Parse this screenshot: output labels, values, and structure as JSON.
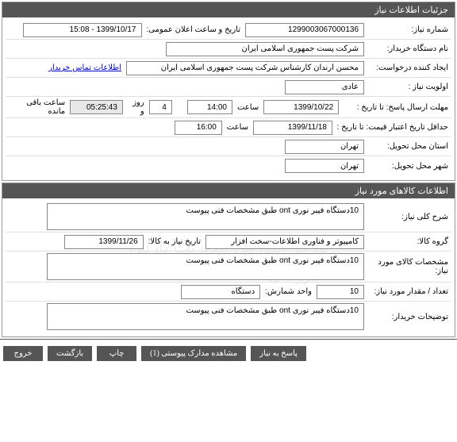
{
  "panel1": {
    "title": "جزئیات اطلاعات نیاز",
    "need_number_label": "شماره نیاز:",
    "need_number": "1299003067000136",
    "public_date_label": "تاریخ و ساعت اعلان عمومی:",
    "public_date": "1399/10/17 - 15:08",
    "buyer_label": "نام دستگاه خریدار:",
    "buyer": "شرکت پست جمهوری اسلامی ایران",
    "creator_label": "ایجاد کننده درخواست:",
    "creator": "محسن ارندان کارشناس شرکت پست جمهوری اسلامی ایران",
    "contact_link": "اطلاعات تماس خریدار",
    "priority_label": "اولویت نیاز :",
    "priority": "عادی",
    "deadline_label": "مهلت ارسال پاسخ:",
    "until_date_label": "تا تاریخ :",
    "until_date": "1399/10/22",
    "hour_label": "ساعت",
    "until_time": "14:00",
    "days_label": "روز و",
    "days_value": "4",
    "remain_time": "05:25:43",
    "remain_label": "ساعت باقی مانده",
    "min_validity_label": "حداقل تاریخ اعتبار قیمت:",
    "validity_until_label": "تا تاریخ :",
    "validity_date": "1399/11/18",
    "validity_time": "16:00",
    "province_label": "استان محل تحویل:",
    "province": "تهران",
    "city_label": "شهر محل تحویل:",
    "city": "تهران"
  },
  "panel2": {
    "title": "اطلاعات کالاهای مورد نیاز",
    "desc_label": "شرح کلی نیاز:",
    "desc": "10دستگاه فیبر نوری ont طبق مشخصات فنی پیوست",
    "group_label": "گروه کالا:",
    "group": "کامپیوتر و فناوری اطلاعات-سخت افزار",
    "delivery_label": "تاریخ نیاز به کالا:",
    "delivery": "1399/11/26",
    "spec_label": "مشخصات کالای مورد نیاز:",
    "spec": "10دستگاه فیبر نوری ont طبق مشخصات فنی پیوست",
    "qty_label": "تعداد / مقدار مورد نیاز:",
    "qty": "10",
    "unit_label": "واحد شمارش:",
    "unit": "دستگاه",
    "notes_label": "توضیحات خریدار:",
    "notes": "10دستگاه فیبر نوری ont طبق مشخصات فنی پیوست"
  },
  "buttons": {
    "respond": "پاسخ به نیاز",
    "attachments": "مشاهده مدارک پیوستی   (1)",
    "print": "چاپ",
    "back": "بازگشت",
    "exit": "خروج"
  },
  "watermark": "ﻣﺮﮐﺰ ﺁﻣﻮﺯﺵ ﻣﺪﯾﺮﯾﺖ ﭘﺎﺭﺱ ﭘﮋﻭﻫﺎﻥ\n۰۲۱-۸۸۲۴۹۶۷۰-۵"
}
